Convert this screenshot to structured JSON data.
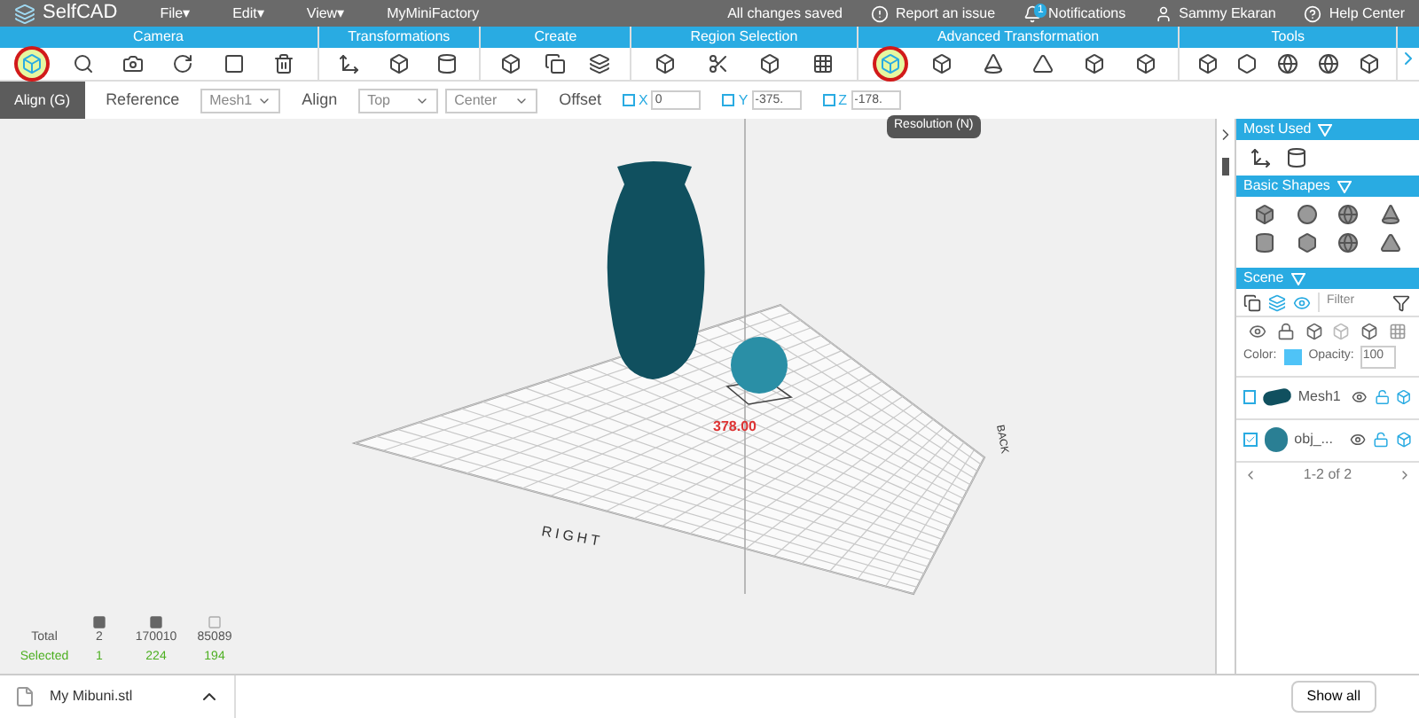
{
  "menu_bar": {
    "logo": "SelfCAD",
    "menus": [
      "File▾",
      "Edit▾",
      "View▾"
    ],
    "project": "MyMiniFactory",
    "status": "All changes saved",
    "report": "Report an issue",
    "notifications": {
      "label": "Notifications",
      "badge": "1"
    },
    "user": "Sammy Ekaran",
    "help": "Help Center"
  },
  "toolbar": {
    "sections": [
      {
        "label": "Camera",
        "tools": [
          {
            "selected": true
          },
          {
            "selected": false
          },
          {
            "selected": false
          },
          {
            "selected": false
          },
          {
            "selected": false
          },
          {
            "selected": false
          }
        ]
      },
      {
        "label": "Transformations",
        "tools": [
          {
            "selected": false
          },
          {
            "selected": false
          },
          {
            "selected": false
          }
        ]
      },
      {
        "label": "Create",
        "tools": [
          {
            "selected": false
          },
          {
            "selected": false
          },
          {
            "selected": false
          }
        ]
      },
      {
        "label": "Region Selection",
        "tools": [
          {
            "selected": false
          },
          {
            "selected": false
          },
          {
            "selected": false
          },
          {
            "selected": false
          }
        ]
      },
      {
        "label": "Advanced Transformation",
        "tools": [
          {
            "selected": true
          },
          {
            "selected": false
          },
          {
            "selected": false
          },
          {
            "selected": false
          },
          {
            "selected": false
          },
          {
            "selected": false
          }
        ]
      },
      {
        "label": "Tools",
        "tools": [
          {
            "selected": false
          },
          {
            "selected": false
          },
          {
            "selected": false
          },
          {
            "selected": false
          },
          {
            "selected": false
          }
        ]
      }
    ],
    "tooltip": "Resolution (N)"
  },
  "align_bar": {
    "title": "Align (G)",
    "reference_label": "Reference",
    "reference": "Mesh1",
    "align_label": "Align",
    "align_vertical": "Top",
    "align_horizontal": "Center",
    "offset_label": "Offset",
    "offsets": [
      {
        "axis": "X",
        "value": "0",
        "checked": false
      },
      {
        "axis": "Y",
        "value": "-375.",
        "checked": false
      },
      {
        "axis": "Z",
        "value": "-178.",
        "checked": false
      }
    ]
  },
  "viewport": {
    "labels": {
      "right": "RIGHT",
      "back": "BACK",
      "dimension": "378.00"
    },
    "stats": {
      "rows": [
        {
          "label": "Total",
          "values": [
            "2",
            "170010",
            "85089"
          ],
          "kind": "total"
        },
        {
          "label": "Selected",
          "values": [
            "1",
            "224",
            "194"
          ],
          "kind": "selected"
        }
      ]
    }
  },
  "right_panel": {
    "most_used": "Most Used",
    "basic_shapes": "Basic Shapes",
    "scene": "Scene",
    "filter_placeholder": "Filter",
    "color_label": "Color:",
    "opacity_label": "Opacity:",
    "opacity": "100",
    "objects": [
      {
        "name": "Mesh1",
        "checked": false,
        "kind": "vase"
      },
      {
        "name": "obj_...",
        "checked": true,
        "kind": "sphere"
      }
    ],
    "pagination": "1-2 of 2"
  },
  "download_bar": {
    "file": "My Mibuni.stl",
    "show_all": "Show all"
  }
}
